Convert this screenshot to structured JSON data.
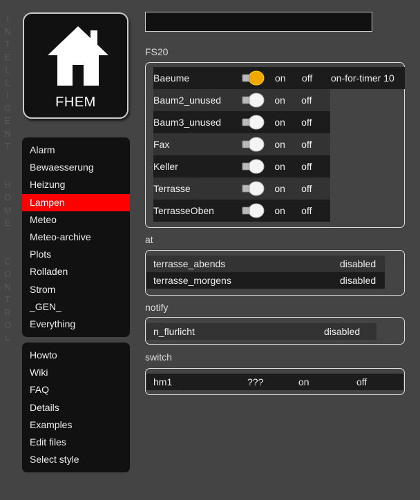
{
  "side_text": "INTELLIGENT HOME CONTROL",
  "logo": {
    "text": "FHEM"
  },
  "search": {
    "value": ""
  },
  "menu_rooms": [
    {
      "label": "Alarm",
      "active": false
    },
    {
      "label": "Bewaesserung",
      "active": false
    },
    {
      "label": "Heizung",
      "active": false
    },
    {
      "label": "Lampen",
      "active": true
    },
    {
      "label": "Meteo",
      "active": false
    },
    {
      "label": "Meteo-archive",
      "active": false
    },
    {
      "label": "Plots",
      "active": false
    },
    {
      "label": "Rolladen",
      "active": false
    },
    {
      "label": "Strom",
      "active": false
    },
    {
      "label": "_GEN_",
      "active": false
    },
    {
      "label": "Everything",
      "active": false
    }
  ],
  "menu_tools": [
    {
      "label": "Howto"
    },
    {
      "label": "Wiki"
    },
    {
      "label": "FAQ"
    },
    {
      "label": "Details"
    },
    {
      "label": "Examples"
    },
    {
      "label": "Edit files"
    },
    {
      "label": "Select style"
    }
  ],
  "groups": {
    "fs20": {
      "title": "FS20",
      "devices": [
        {
          "name": "Baeume",
          "state": "on",
          "on": "on",
          "off": "off",
          "timer": "on-for-timer 10"
        },
        {
          "name": "Baum2_unused",
          "state": "off",
          "on": "on",
          "off": "off"
        },
        {
          "name": "Baum3_unused",
          "state": "off",
          "on": "on",
          "off": "off"
        },
        {
          "name": "Fax",
          "state": "off",
          "on": "on",
          "off": "off"
        },
        {
          "name": "Keller",
          "state": "off",
          "on": "on",
          "off": "off"
        },
        {
          "name": "Terrasse",
          "state": "off",
          "on": "on",
          "off": "off"
        },
        {
          "name": "TerrasseOben",
          "state": "off",
          "on": "on",
          "off": "off"
        }
      ]
    },
    "at": {
      "title": "at",
      "rows": [
        {
          "name": "terrasse_abends",
          "state": "disabled"
        },
        {
          "name": "terrasse_morgens",
          "state": "disabled"
        }
      ]
    },
    "notify": {
      "title": "notify",
      "rows": [
        {
          "name": "n_flurlicht",
          "state": "disabled"
        }
      ]
    },
    "switch": {
      "title": "switch",
      "rows": [
        {
          "name": "hm1",
          "state": "???",
          "on": "on",
          "off": "off"
        }
      ]
    }
  },
  "colors": {
    "accent": "#ff0000",
    "background": "#444444",
    "panel": "#111111",
    "bulb_on": "#f0a800"
  }
}
